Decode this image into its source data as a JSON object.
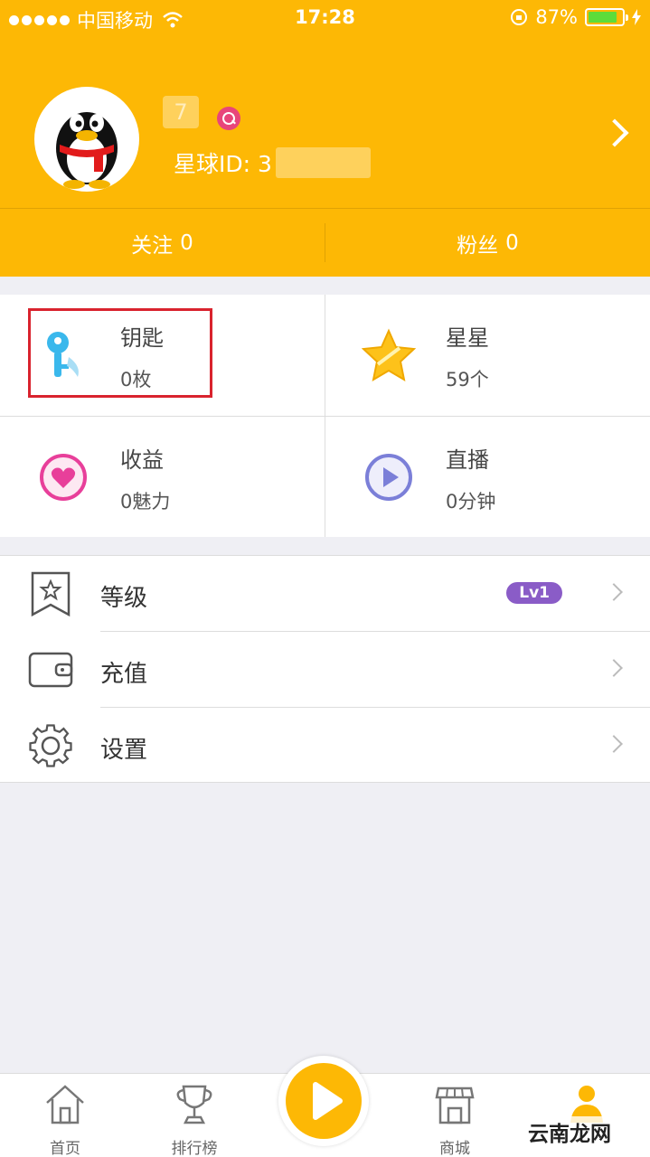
{
  "status_bar": {
    "carrier": "中国移动",
    "time": "17:28",
    "battery": "87%",
    "battery_level": 0.87
  },
  "profile": {
    "nickname": "7",
    "star_id_label": "星球ID: 3",
    "follow_label": "关注",
    "follow_count": "0",
    "fans_label": "粉丝",
    "fans_count": "0"
  },
  "assets": [
    {
      "title": "钥匙",
      "value": "0枚",
      "icon": "key-icon"
    },
    {
      "title": "星星",
      "value": "59个",
      "icon": "star-icon"
    },
    {
      "title": "收益",
      "value": "0魅力",
      "icon": "heart-icon"
    },
    {
      "title": "直播",
      "value": "0分钟",
      "icon": "play-icon"
    }
  ],
  "menu": [
    {
      "label": "等级",
      "badge": "Lv1",
      "icon": "bookmark-star-icon"
    },
    {
      "label": "充值",
      "icon": "wallet-icon"
    },
    {
      "label": "设置",
      "icon": "gear-icon"
    }
  ],
  "tabbar": {
    "home": "首页",
    "ranking": "排行榜",
    "shop": "商城"
  },
  "watermark": "云南龙网",
  "colors": {
    "brand": "#fdb805",
    "highlight_box": "#d9232e",
    "level_badge": "#8a5cc7"
  }
}
